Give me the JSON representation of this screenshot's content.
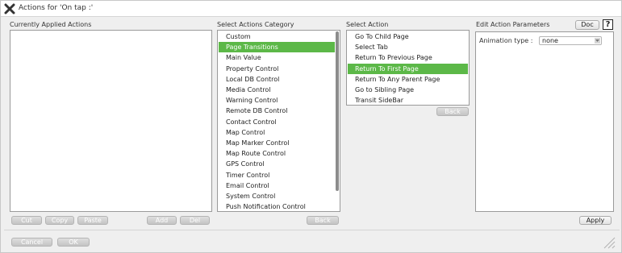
{
  "dialog": {
    "title": "Actions for 'On tap :'"
  },
  "applied": {
    "heading": "Currently Applied Actions",
    "buttons": {
      "cut": "Cut",
      "copy": "Copy",
      "paste": "Paste",
      "add": "Add",
      "del": "Del"
    }
  },
  "category": {
    "heading": "Select Actions Category",
    "items": [
      "Custom",
      "Page Transitions",
      "Main Value",
      "Property Control",
      "Local DB Control",
      "Media Control",
      "Warning Control",
      "Remote DB Control",
      "Contact Control",
      "Map Control",
      "Map Marker Control",
      "Map Route Control",
      "GPS Control",
      "Timer Control",
      "Email Control",
      "System Control",
      "Push Notification Control"
    ],
    "selected": "Page Transitions",
    "back_label": "Back"
  },
  "action": {
    "heading": "Select Action",
    "items": [
      "Go To Child Page",
      "Select Tab",
      "Return To Previous Page",
      "Return To First Page",
      "Return To Any Parent Page",
      "Go to Sibling Page",
      "Transit SideBar"
    ],
    "selected": "Return To First Page",
    "back_label": "Back"
  },
  "params": {
    "heading": "Edit Action Parameters",
    "doc_label": "Doc",
    "help_symbol": "?",
    "animation_label": "Animation type :",
    "animation_value": "none",
    "apply_label": "Apply"
  },
  "footer": {
    "cancel_label": "Cancel",
    "ok_label": "OK"
  }
}
